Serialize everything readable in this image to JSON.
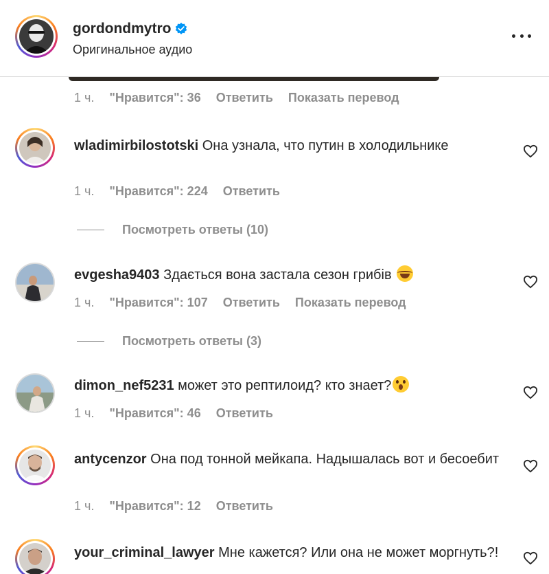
{
  "header": {
    "username": "gordondmytro",
    "subtitle": "Оригинальное аудио"
  },
  "top_meta": {
    "time": "1 ч.",
    "likes": "\"Нравится\": 36",
    "reply": "Ответить",
    "translate": "Показать перевод"
  },
  "comments": [
    {
      "user": "wladimirbilostotski",
      "text": "Она узнала, что путин в холодильнике",
      "time": "1 ч.",
      "likes": "\"Нравится\": 224",
      "reply": "Ответить",
      "view_replies": "Посмотреть ответы (10)"
    },
    {
      "user": "evgesha9403",
      "text": "Здається вона застала сезон грибів",
      "emoji": "laughing-face",
      "time": "1 ч.",
      "likes": "\"Нравится\": 107",
      "reply": "Ответить",
      "translate": "Показать перевод",
      "view_replies": "Посмотреть ответы (3)"
    },
    {
      "user": "dimon_nef5231",
      "text": "может это рептилоид? кто знает?",
      "emoji": "astonished-face",
      "time": "1 ч.",
      "likes": "\"Нравится\": 46",
      "reply": "Ответить"
    },
    {
      "user": "antycenzor",
      "text": "Она под тонной мейкапа. Надышалась вот и бесоебит",
      "time": "1 ч.",
      "likes": "\"Нравится\": 12",
      "reply": "Ответить"
    },
    {
      "user": "your_criminal_lawyer",
      "text": "Мне кажется? Или она не может моргнуть?!"
    }
  ],
  "colors": {
    "text": "#262626",
    "muted": "#8e8e8e",
    "verified": "#0095f6"
  }
}
